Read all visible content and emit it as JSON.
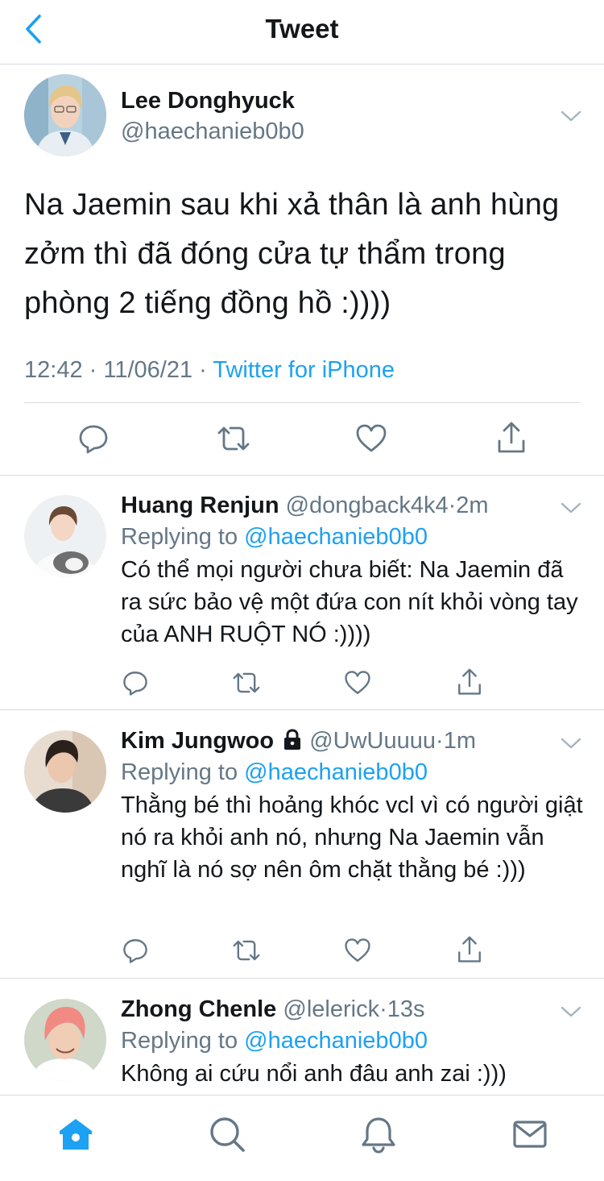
{
  "header": {
    "title": "Tweet",
    "back_icon": "chevron-left-icon"
  },
  "colors": {
    "accent": "#1da1f2",
    "muted": "#657786",
    "text": "#14171a",
    "divider": "#d7dbdf"
  },
  "main_tweet": {
    "author_name": "Lee Donghyuck",
    "author_handle": "@haechanieb0b0",
    "text": "Na Jaemin sau khi xả thân là anh hùng zởm thì đã đóng cửa tự thẩm trong phòng 2 tiếng đồng hồ :))))",
    "time": "12:42",
    "date": "11/06/21",
    "separator": " · ",
    "source": "Twitter for iPhone"
  },
  "replies": [
    {
      "name": "Huang Renjun",
      "handle": "@dongback4k4",
      "time": "2m",
      "locked": false,
      "replying_label": "Replying to ",
      "replying_to": "@haechanieb0b0",
      "text": "Có thể mọi người chưa biết: Na Jaemin đã ra sức bảo vệ một đứa con nít khỏi vòng tay của ANH RUỘT NÓ :))))"
    },
    {
      "name": "Kim Jungwoo",
      "handle": "@UwUuuuu",
      "time": "1m",
      "locked": true,
      "replying_label": "Replying to ",
      "replying_to": "@haechanieb0b0",
      "text": "Thằng bé thì hoảng khóc vcl vì có người giật nó ra khỏi anh nó, nhưng Na Jaemin vẫn nghĩ là nó sợ nên ôm chặt thằng bé :)))"
    },
    {
      "name": "Zhong Chenle",
      "handle": "@lelerick",
      "time": "13s",
      "locked": false,
      "replying_label": "Replying to ",
      "replying_to": "@haechanieb0b0",
      "text": "Không ai cứu nổi anh đâu anh zai :)))"
    }
  ],
  "tabs": [
    "home-icon",
    "search-icon",
    "notifications-icon",
    "messages-icon"
  ]
}
